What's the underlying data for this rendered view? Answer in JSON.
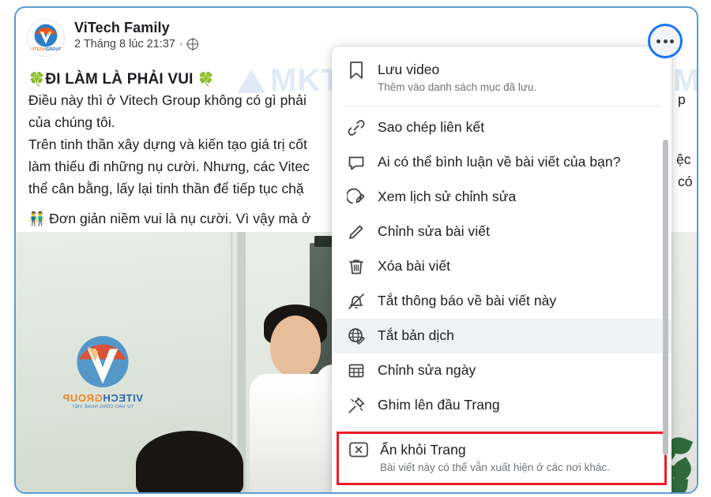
{
  "post": {
    "page_name": "ViTech Family",
    "timestamp": "2 Tháng 8 lúc 21:37",
    "time_separator": "·",
    "privacy_icon": "globe-icon",
    "avatar_alt": "ViTech Group logo",
    "avatar_text_1": "VITECH",
    "avatar_text_2": "GROUP",
    "title_emoji_left": "🍀",
    "title": "ĐI LÀM LÀ PHẢI VUI",
    "title_emoji_right": "🍀",
    "lines": [
      "Điều này thì ở Vitech Group không có gì phải",
      "của chúng tôi.",
      "Trên tinh thần xây dựng và kiến tạo giá trị cốt",
      "làm thiếu đi những nụ cười. Nhưng, các Vitec",
      "thể cân bằng, lấy lại tinh thần để tiếp tục chặ"
    ],
    "closing_emoji": "👬",
    "closing_line": "Đơn giản niềm vui là nụ cười. Vì vậy mà ở",
    "occluded_fragments": [
      "p",
      "ệc",
      "có"
    ],
    "photo_logo": {
      "name_part_1": "VITECH",
      "name_part_2": "GROUP",
      "tagline": "TỰ HÀO CÔNG NGHỆ VIỆT"
    }
  },
  "watermark": {
    "text": "MKT",
    "color": "#dfeaf6"
  },
  "more_button": {
    "name": "more-options-button",
    "icon": "ellipsis-icon",
    "focus_color": "#1877f2"
  },
  "menu": {
    "items": [
      {
        "icon": "bookmark-icon",
        "label": "Lưu video",
        "sublabel": "Thêm vào danh sách mục đã lưu.",
        "state": "normal",
        "separator_after": true
      },
      {
        "icon": "link-icon",
        "label": "Sao chép liên kết",
        "sublabel": "",
        "state": "normal",
        "separator_after": false
      },
      {
        "icon": "comment-bubble-icon",
        "label": "Ai có thể bình luận về bài viết của bạn?",
        "sublabel": "",
        "state": "normal",
        "separator_after": false
      },
      {
        "icon": "edit-history-icon",
        "label": "Xem lịch sử chỉnh sửa",
        "sublabel": "",
        "state": "normal",
        "separator_after": false
      },
      {
        "icon": "pencil-icon",
        "label": "Chỉnh sửa bài viết",
        "sublabel": "",
        "state": "normal",
        "separator_after": false
      },
      {
        "icon": "trash-icon",
        "label": "Xóa bài viết",
        "sublabel": "",
        "state": "normal",
        "separator_after": false
      },
      {
        "icon": "bell-off-icon",
        "label": "Tắt thông báo về bài viết này",
        "sublabel": "",
        "state": "normal",
        "separator_after": false
      },
      {
        "icon": "globe-translate-icon",
        "label": "Tắt bản dịch",
        "sublabel": "",
        "state": "hover",
        "separator_after": false
      },
      {
        "icon": "calendar-grid-icon",
        "label": "Chỉnh sửa ngày",
        "sublabel": "",
        "state": "normal",
        "separator_after": false
      },
      {
        "icon": "pin-icon",
        "label": "Ghim lên đầu Trang",
        "sublabel": "",
        "state": "normal",
        "separator_after": true
      },
      {
        "icon": "x-box-icon",
        "label": "Ẩn khỏi Trang",
        "sublabel": "Bài viết này có thể vẫn xuất hiện ở các nơi khác.",
        "state": "highlighted",
        "separator_after": false
      }
    ],
    "highlight_color": "#ee1c25",
    "hover_color": "#f1f2f3",
    "scrollbar": "menu-scrollbar"
  }
}
